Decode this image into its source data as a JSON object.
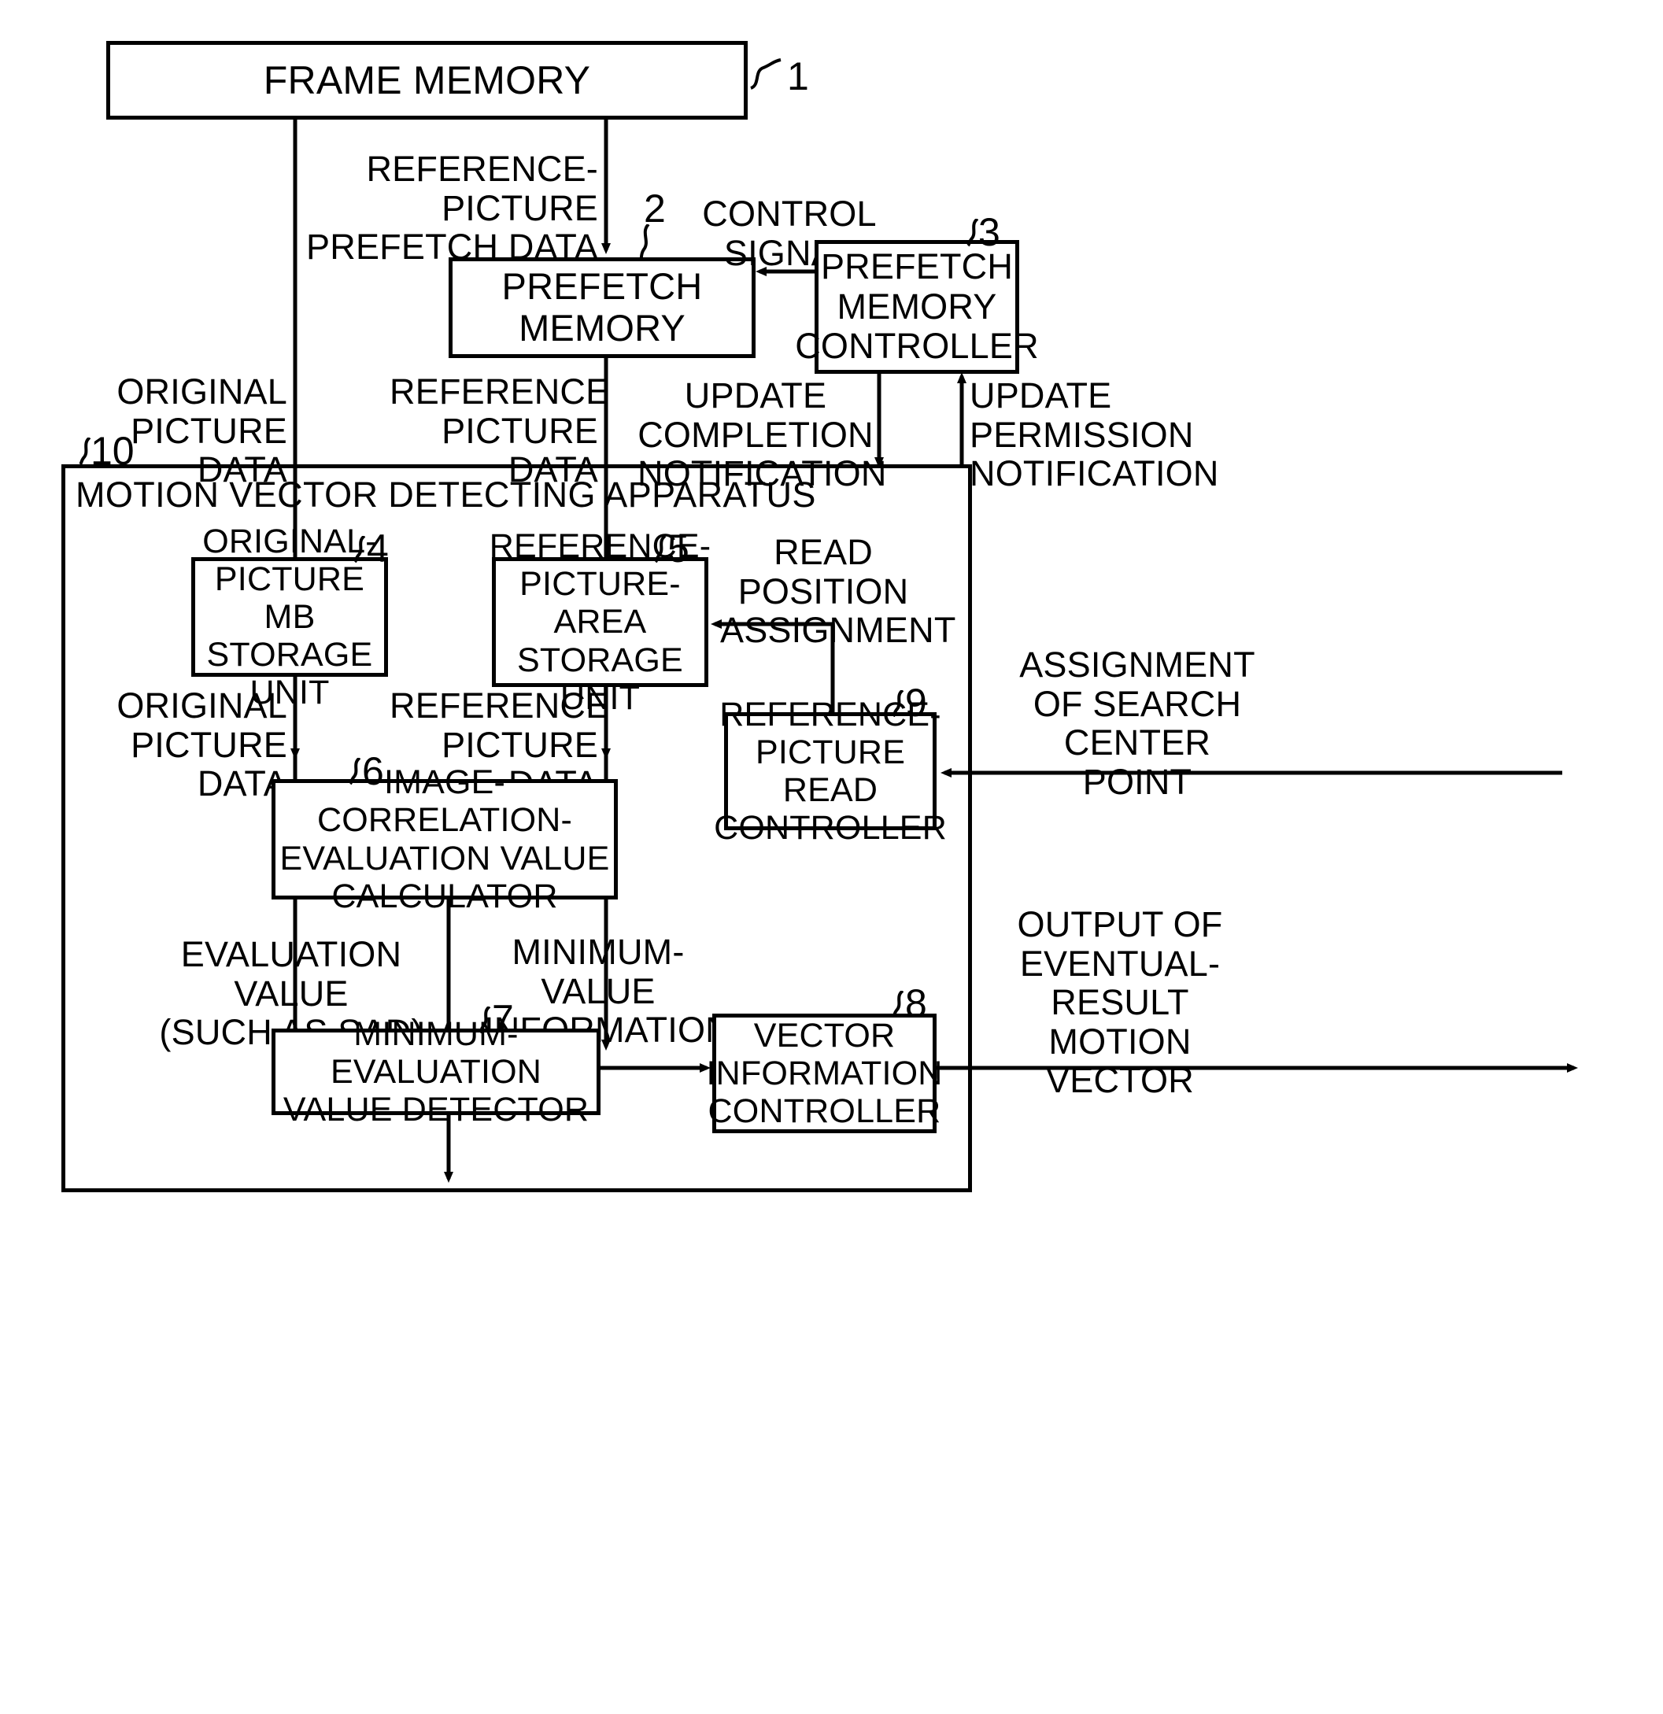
{
  "figure": {
    "type": "block-diagram",
    "title": "MOTION VECTOR DETECTING APPARATUS"
  },
  "blocks": {
    "frame_memory": {
      "label": "FRAME MEMORY",
      "ref": "1"
    },
    "prefetch_memory": {
      "label": "PREFETCH MEMORY",
      "ref": "2"
    },
    "prefetch_memory_controller": {
      "label": "PREFETCH\nMEMORY\nCONTROLLER",
      "ref": "3"
    },
    "original_picture_mb_storage_unit": {
      "label": "ORIGINAL-\nPICTURE MB\nSTORAGE\nUNIT",
      "ref": "4"
    },
    "reference_picture_area_storage_unit": {
      "label": "REFERENCE-\nPICTURE-\nAREA\nSTORAGE UNIT",
      "ref": "5"
    },
    "image_correlation_evaluation_value_calculator": {
      "label": "IMAGE-CORRELATION-\nEVALUATION VALUE\nCALCULATOR",
      "ref": "6"
    },
    "minimum_evaluation_value_detector": {
      "label": "MINIMUM-EVALUATION\nVALUE DETECTOR",
      "ref": "7"
    },
    "vector_information_controller": {
      "label": "VECTOR\nINFORMATION\nCONTROLLER",
      "ref": "8"
    },
    "reference_picture_read_controller": {
      "label": "REFERENCE-\nPICTURE\nREAD\nCONTROLLER",
      "ref": "9"
    },
    "motion_vector_detecting_apparatus": {
      "label": "MOTION VECTOR DETECTING APPARATUS",
      "ref": "10"
    }
  },
  "signals": {
    "reference_picture_prefetch_data": "REFERENCE-\nPICTURE\nPREFETCH DATA",
    "control_signal": "CONTROL\nSIGNAL",
    "original_picture_data_top": "ORIGINAL\nPICTURE\nDATA",
    "reference_picture_data_top": "REFERENCE\nPICTURE\nDATA",
    "update_completion_notification": "UPDATE\nCOMPLETION\nNOTIFICATION",
    "update_permission_notification": "UPDATE\nPERMISSION\nNOTIFICATION",
    "original_picture_data_mid": "ORIGINAL\nPICTURE\nDATA",
    "reference_picture_data_mid": "REFERENCE\nPICTURE\nDATA",
    "read_position_assignment": "READ\nPOSITION\nASSIGNMENT",
    "assignment_of_search_center_point": "ASSIGNMENT\nOF SEARCH\nCENTER\nPOINT",
    "evaluation_value": "EVALUATION VALUE\n(SUCH AS SAD)",
    "minimum_value_information": "MINIMUM-\nVALUE\nINFORMATION",
    "output_of_eventual_result_motion_vector": "OUTPUT OF\nEVENTUAL-\nRESULT\nMOTION\nVECTOR"
  },
  "colors": {
    "ink": "#000000",
    "paper": "#ffffff"
  }
}
